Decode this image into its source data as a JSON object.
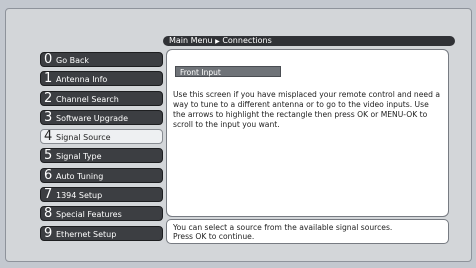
{
  "breadcrumb": {
    "parent": "Main Menu",
    "separator": "▶",
    "current": "Connections"
  },
  "menu": {
    "items": [
      {
        "num": "0",
        "label": "Go Back"
      },
      {
        "num": "1",
        "label": "Antenna Info"
      },
      {
        "num": "2",
        "label": "Channel Search"
      },
      {
        "num": "3",
        "label": "Software Upgrade"
      },
      {
        "num": "4",
        "label": "Signal Source"
      },
      {
        "num": "5",
        "label": "Signal Type"
      },
      {
        "num": "6",
        "label": "Auto Tuning"
      },
      {
        "num": "7",
        "label": "1394 Setup"
      },
      {
        "num": "8",
        "label": "Special Features"
      },
      {
        "num": "9",
        "label": "Ethernet Setup"
      }
    ],
    "selected": "4"
  },
  "panel": {
    "subtitle": "Front Input",
    "body": "Use this screen if you have misplaced your remote control and need a way to tune to a different antenna or to go to the video inputs. Use the arrows to highlight the rectangle then press OK or MENU-OK to scroll to the input you want."
  },
  "footer": {
    "line1": "You can select a source from the available signal sources.",
    "line2": "Press OK to continue."
  }
}
